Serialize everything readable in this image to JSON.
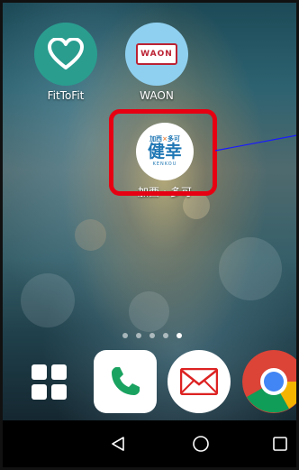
{
  "home": {
    "apps": [
      {
        "label": "FitToFit",
        "icon": "heart-icon",
        "color": "#2a9d8f"
      },
      {
        "label": "WAON",
        "icon": "waon-logo-icon",
        "color": "#8fd0f0"
      },
      {
        "label": "加西・多可",
        "icon": "kenkou-logo-icon",
        "color": "#ffffff"
      }
    ],
    "page_indicator": {
      "count": 5,
      "active": 4
    },
    "dock": [
      {
        "name": "app-drawer",
        "icon": "grid-icon"
      },
      {
        "name": "phone",
        "icon": "phone-icon",
        "color": "#1aa260"
      },
      {
        "name": "mail",
        "icon": "mail-icon",
        "color": "#d22"
      },
      {
        "name": "chrome",
        "icon": "chrome-icon"
      }
    ],
    "highlight_color": "#e60012"
  },
  "kenkou_icon": {
    "top_text": "加西",
    "separator": "×",
    "top_text2": "多可",
    "main_text": "健幸",
    "sub_text": "KENKOU"
  },
  "waon_icon": {
    "logo_text": "WAON"
  },
  "navbar": {
    "back": "back-icon",
    "home": "home-icon",
    "recents": "recents-icon"
  }
}
